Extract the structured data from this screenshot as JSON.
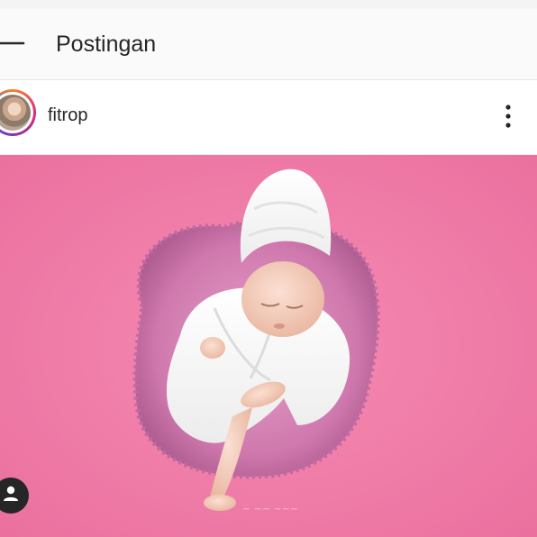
{
  "header": {
    "title": "Postingan",
    "back_icon": "arrow-left-icon"
  },
  "post": {
    "username": "fitrop",
    "avatar_icon": "profile-avatar",
    "more_icon": "more-vertical-icon",
    "image_description_icon": "photo",
    "tag_icon": "user-tag-icon",
    "colors": {
      "background": "#f07aa6",
      "fur": "#d684b5"
    }
  }
}
